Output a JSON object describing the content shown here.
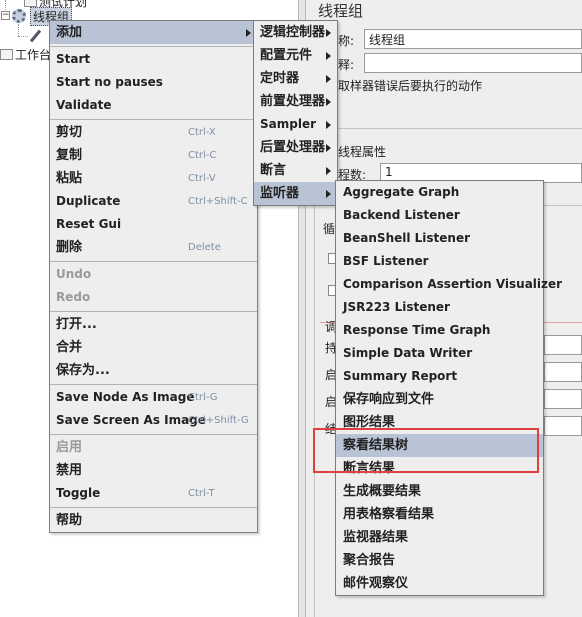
{
  "tree": {
    "root_label": "测试计划",
    "thread_group_label": "线程组",
    "workbench_label": "工作台"
  },
  "right_panel": {
    "title": "线程组",
    "name_label": "称:",
    "name_value": "线程组",
    "comment_label": "释:",
    "error_action_label": "取样器错误后要执行的动作",
    "thread_props_label": "线程属性",
    "thread_count_label": "程数:",
    "thread_count_value": "1",
    "frag_a": "循",
    "frag_b": "调",
    "frag_c": "持",
    "frag_d": "启",
    "frag_e": "启",
    "frag_f": "结"
  },
  "main_menu": {
    "add": "添加",
    "start": "Start",
    "start_no_pauses": "Start no pauses",
    "validate": "Validate",
    "cut": "剪切",
    "cut_accel": "Ctrl-X",
    "copy": "复制",
    "copy_accel": "Ctrl-C",
    "paste": "粘贴",
    "paste_accel": "Ctrl-V",
    "duplicate": "Duplicate",
    "duplicate_accel": "Ctrl+Shift-C",
    "reset_gui": "Reset Gui",
    "delete": "删除",
    "delete_accel": "Delete",
    "undo": "Undo",
    "redo": "Redo",
    "open": "打开...",
    "merge": "合并",
    "save_as": "保存为...",
    "save_node_image": "Save Node As Image",
    "save_node_image_accel": "Ctrl-G",
    "save_screen_image": "Save Screen As Image",
    "save_screen_image_accel": "Ctrl+Shift-G",
    "enable": "启用",
    "disable": "禁用",
    "toggle": "Toggle",
    "toggle_accel": "Ctrl-T",
    "help": "帮助"
  },
  "add_submenu": [
    {
      "label": "逻辑控制器"
    },
    {
      "label": "配置元件"
    },
    {
      "label": "定时器"
    },
    {
      "label": "前置处理器"
    },
    {
      "label": "Sampler"
    },
    {
      "label": "后置处理器"
    },
    {
      "label": "断言"
    },
    {
      "label": "监听器"
    }
  ],
  "listener_submenu": [
    {
      "label": "Aggregate Graph"
    },
    {
      "label": "Backend Listener"
    },
    {
      "label": "BeanShell Listener"
    },
    {
      "label": "BSF Listener"
    },
    {
      "label": "Comparison Assertion Visualizer"
    },
    {
      "label": "JSR223 Listener"
    },
    {
      "label": "Response Time Graph"
    },
    {
      "label": "Simple Data Writer"
    },
    {
      "label": "Summary Report"
    },
    {
      "label": "保存响应到文件"
    },
    {
      "label": "图形结果"
    },
    {
      "label": "察看结果树"
    },
    {
      "label": "断言结果"
    },
    {
      "label": "生成概要结果"
    },
    {
      "label": "用表格察看结果"
    },
    {
      "label": "监视器结果"
    },
    {
      "label": "聚合报告"
    },
    {
      "label": "邮件观察仪"
    }
  ],
  "colors": {
    "selected_item_bg": "#b8c4d5",
    "highlight_box": "#e04040",
    "accelerator_text": "#7f8fa4",
    "disabled_text": "#9a9a9a"
  }
}
